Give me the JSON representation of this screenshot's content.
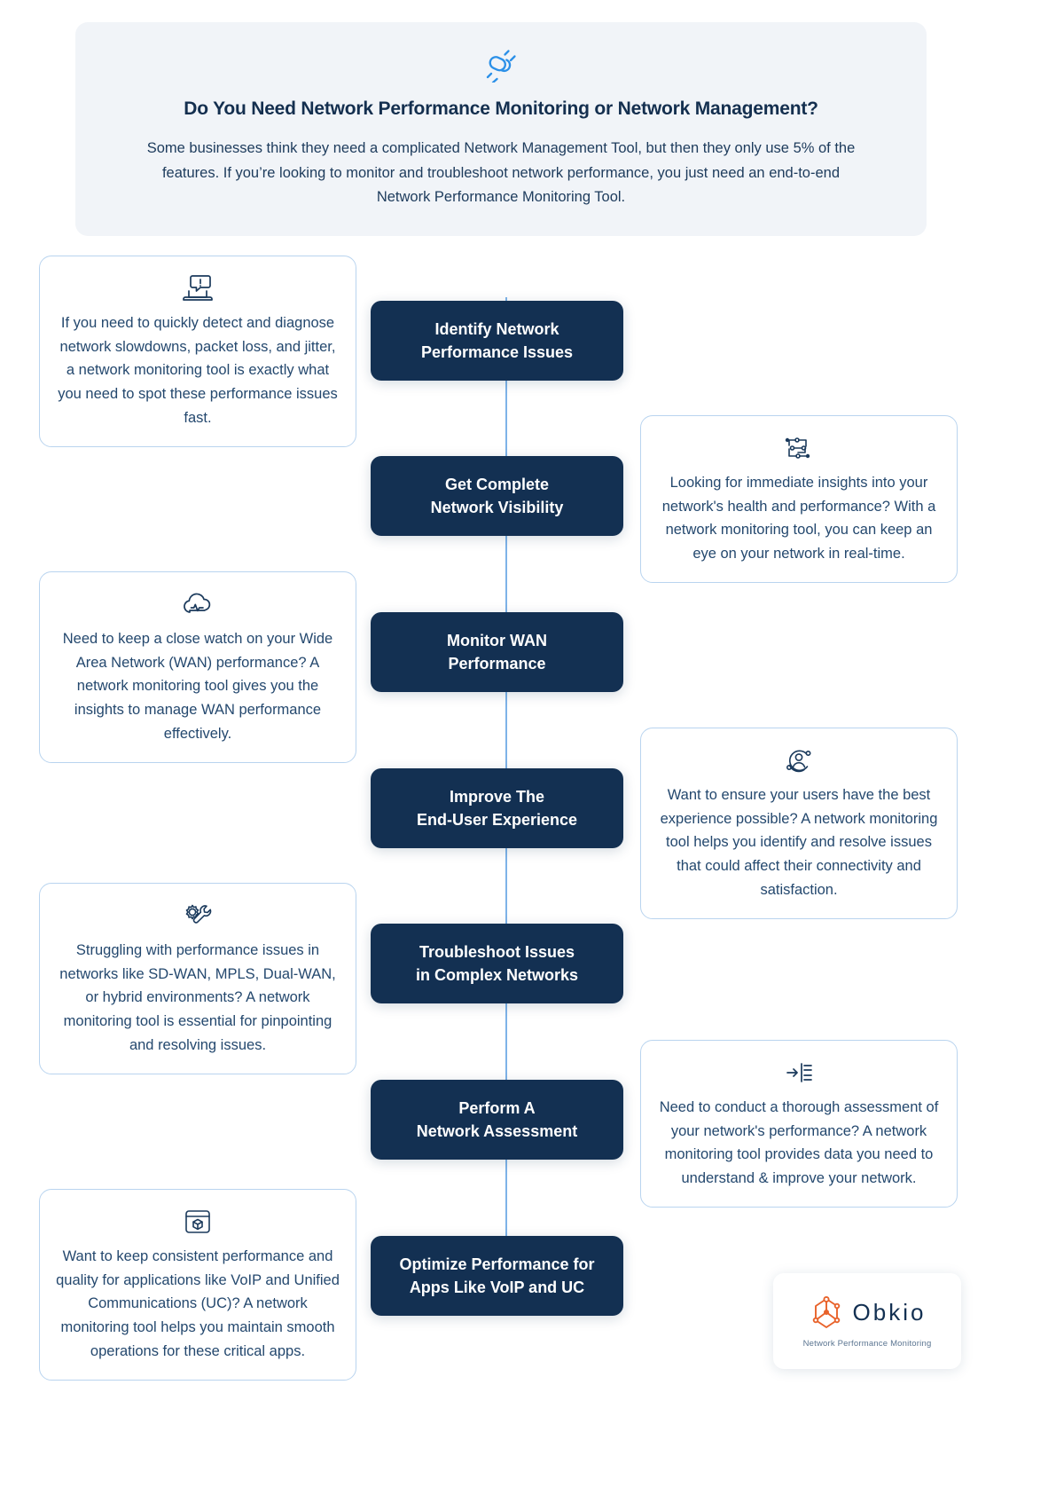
{
  "hero": {
    "icon": "plug-connector-icon",
    "title": "Do You Need Network Performance Monitoring or Network Management?",
    "body": "Some businesses think they need a complicated Network Management Tool, but then they only use 5% of the features. If you’re looking to monitor and troubleshoot network performance, you just need an end-to-end Network Performance Monitoring Tool."
  },
  "colors": {
    "hero_background": "#f1f4f8",
    "step_background": "#133052",
    "spine": "#7eb3e8",
    "card_border": "#b9d4ef",
    "accent_blue": "#2b90e8",
    "logo_orange": "#e8622a",
    "text_dark": "#142f4f"
  },
  "steps": [
    {
      "label": "Identify Network\nPerformance Issues",
      "line1": "Identify Network",
      "line2": "Performance Issues"
    },
    {
      "label": "Get Complete\nNetwork Visibility",
      "line1": "Get Complete",
      "line2": "Network Visibility"
    },
    {
      "label": "Monitor WAN\nPerformance",
      "line1": "Monitor WAN",
      "line2": "Performance"
    },
    {
      "label": "Improve The\nEnd-User Experience",
      "line1": "Improve The",
      "line2": "End-User Experience"
    },
    {
      "label": "Troubleshoot Issues\nin Complex Networks",
      "line1": "Troubleshoot Issues",
      "line2": "in Complex Networks"
    },
    {
      "label": "Perform A\nNetwork Assessment",
      "line1": "Perform A",
      "line2": "Network Assessment"
    },
    {
      "label": "Optimize Performance for\nApps Like VoIP and UC",
      "line1": "Optimize Performance for",
      "line2": "Apps Like VoIP and UC"
    }
  ],
  "cards": [
    {
      "side": "left",
      "icon": "laptop-alert-icon",
      "text": "If you need to quickly detect and diagnose network slowdowns, packet loss, and jitter, a network monitoring tool is exactly what you need to spot these performance issues fast."
    },
    {
      "side": "right",
      "icon": "network-topology-icon",
      "text": "Looking for immediate insights into your network's health and performance? With a network monitoring tool, you can keep an eye on your network in real-time."
    },
    {
      "side": "left",
      "icon": "cloud-pulse-icon",
      "text": "Need to keep a close watch on your Wide Area Network (WAN) performance? A network monitoring tool gives you the insights to manage WAN performance effectively."
    },
    {
      "side": "right",
      "icon": "user-orbit-icon",
      "text": "Want to ensure your users have the best experience possible? A network monitoring tool helps you identify and resolve issues that could affect their connectivity and satisfaction."
    },
    {
      "side": "left",
      "icon": "gear-wrench-icon",
      "text": "Struggling with performance issues in networks like SD-WAN, MPLS, Dual-WAN, or hybrid environments? A network monitoring tool is essential for pinpointing and resolving issues."
    },
    {
      "side": "right",
      "icon": "checklist-arrow-icon",
      "text": "Need to conduct a thorough assessment of your network's performance? A network monitoring tool provides data you need to understand & improve your network."
    },
    {
      "side": "left",
      "icon": "app-box-icon",
      "text": "Want to keep consistent performance and quality for applications like VoIP and Unified Communications (UC)? A network monitoring tool helps you maintain smooth operations for these critical apps."
    }
  ],
  "logo": {
    "icon": "obkio-node-logo-icon",
    "name": "Obkio",
    "tagline": "Network Performance Monitoring"
  }
}
